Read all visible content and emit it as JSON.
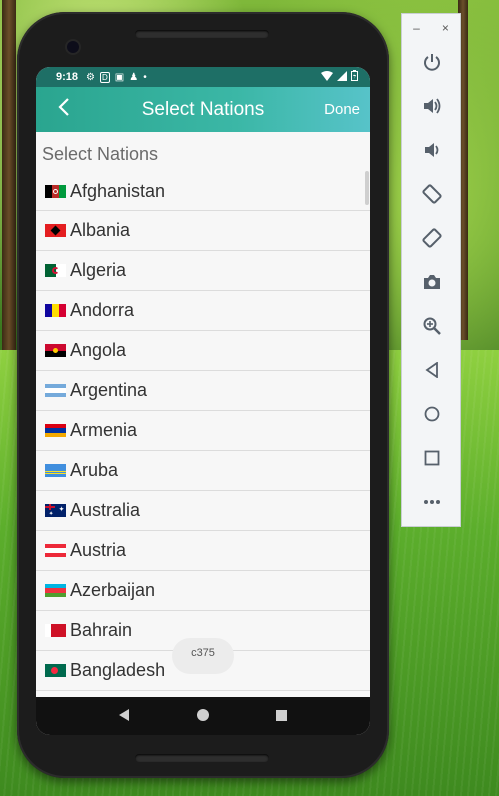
{
  "status_bar": {
    "time": "9:18",
    "icons": [
      "gear-icon",
      "d-badge-icon",
      "image-icon",
      "figure-icon",
      "dot-icon"
    ],
    "right_icons": [
      "wifi-icon",
      "signal-icon",
      "battery-icon"
    ]
  },
  "app_bar": {
    "back_icon": "chevron-left-icon",
    "title": "Select Nations",
    "done_label": "Done"
  },
  "section_header": "Select Nations",
  "nations": [
    {
      "name": "Afghanistan",
      "flag": "af"
    },
    {
      "name": "Albania",
      "flag": "al"
    },
    {
      "name": "Algeria",
      "flag": "dz"
    },
    {
      "name": "Andorra",
      "flag": "ad"
    },
    {
      "name": "Angola",
      "flag": "ao"
    },
    {
      "name": "Argentina",
      "flag": "ar"
    },
    {
      "name": "Armenia",
      "flag": "am"
    },
    {
      "name": "Aruba",
      "flag": "aw"
    },
    {
      "name": "Australia",
      "flag": "au"
    },
    {
      "name": "Austria",
      "flag": "at"
    },
    {
      "name": "Azerbaijan",
      "flag": "az"
    },
    {
      "name": "Bahrain",
      "flag": "bh"
    },
    {
      "name": "Bangladesh",
      "flag": "bd"
    }
  ],
  "toast": "c375",
  "nav_bar": [
    "back-triangle-icon",
    "home-circle-icon",
    "overview-square-icon"
  ],
  "emulator_panel": {
    "window_controls": [
      "minimize-icon",
      "close-icon"
    ],
    "window_control_glyphs": [
      "–",
      "×"
    ],
    "tools": [
      "power-icon",
      "volume-up-icon",
      "volume-down-icon",
      "rotate-left-icon",
      "rotate-right-icon",
      "camera-icon",
      "zoom-icon",
      "back-icon",
      "home-icon",
      "overview-icon",
      "more-icon"
    ]
  },
  "colors": {
    "app_bar_start": "#2aa58f",
    "app_bar_end": "#57c3c9",
    "status_bar": "#1e6f66",
    "list_bg": "#f7f7f7"
  }
}
